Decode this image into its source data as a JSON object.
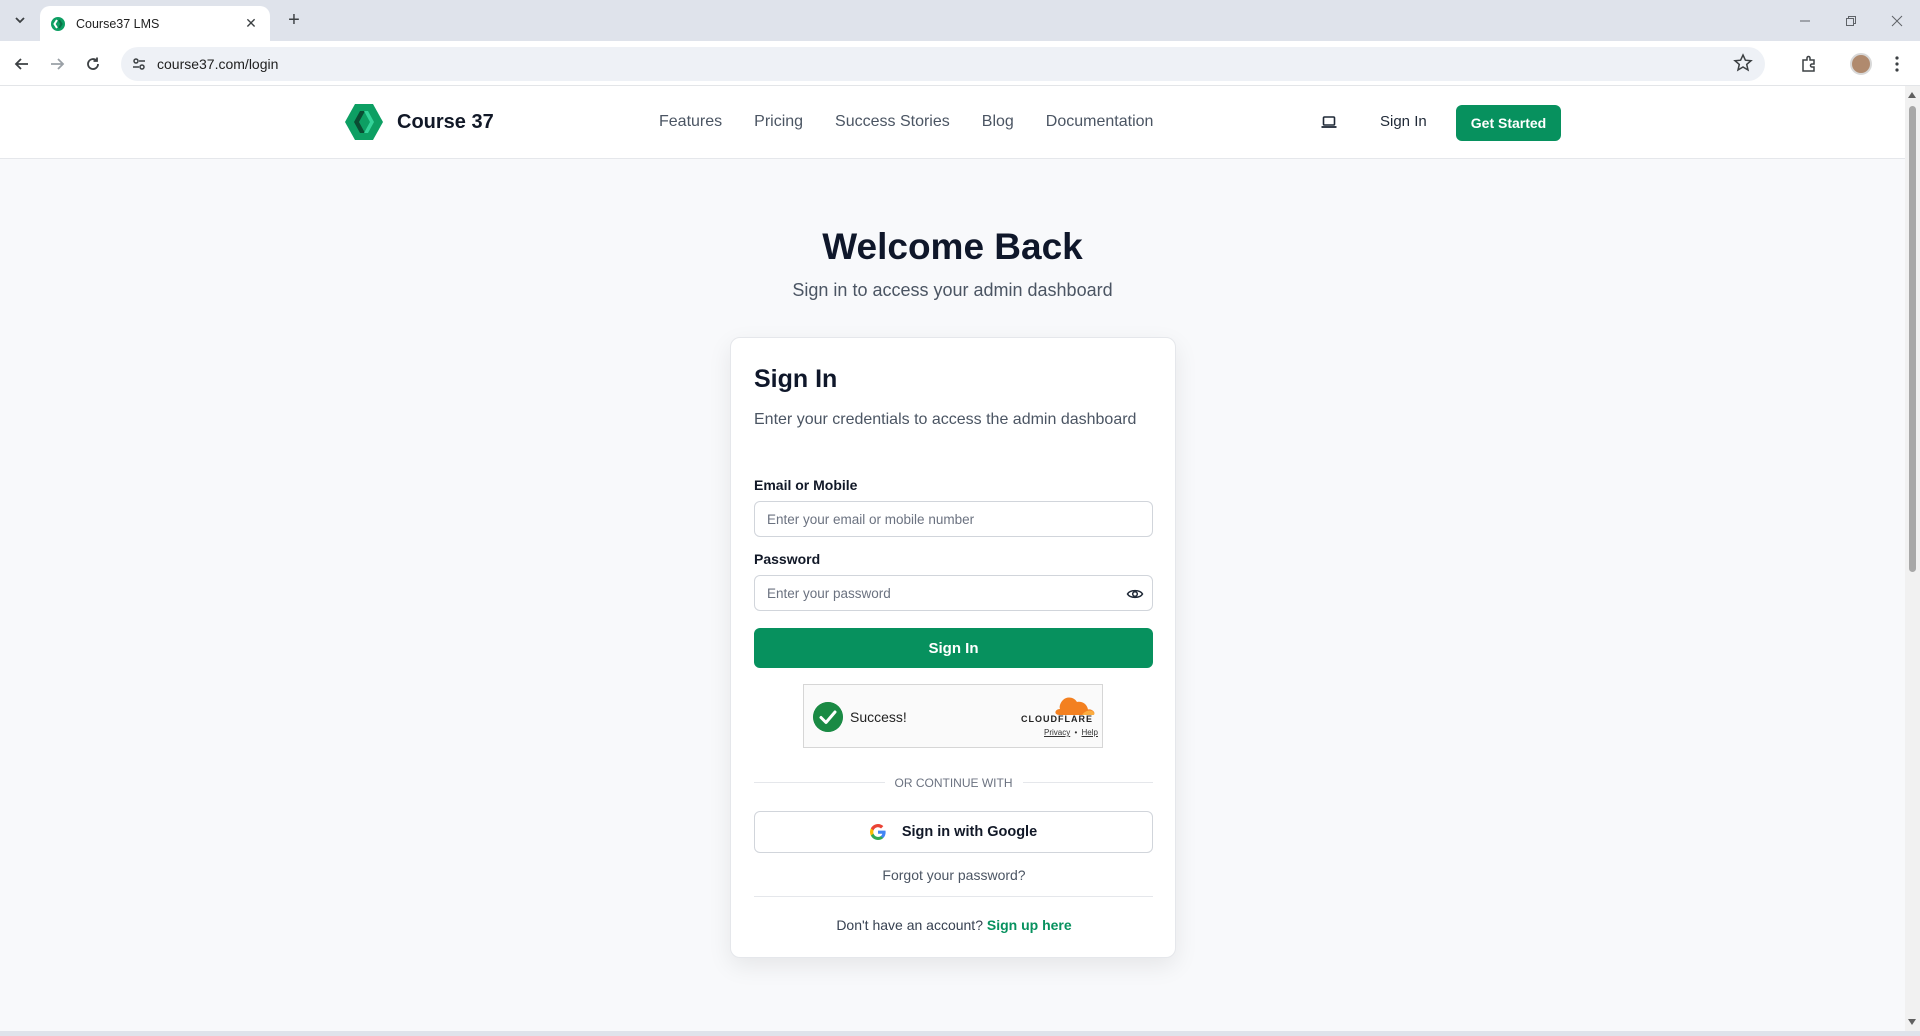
{
  "browser": {
    "tab_title": "Course37 LMS",
    "url": "course37.com/login",
    "new_tab_symbol": "+",
    "tab_close_symbol": "✕"
  },
  "header": {
    "brand_name": "Course 37",
    "nav": [
      "Features",
      "Pricing",
      "Success Stories",
      "Blog",
      "Documentation"
    ],
    "sign_in": "Sign In",
    "get_started": "Get Started"
  },
  "hero": {
    "title": "Welcome Back",
    "subtitle": "Sign in to access your admin dashboard"
  },
  "card": {
    "title": "Sign In",
    "description": "Enter your credentials to access the admin dashboard",
    "email_label": "Email or Mobile",
    "email_placeholder": "Enter your email or mobile number",
    "password_label": "Password",
    "password_placeholder": "Enter your password",
    "submit": "Sign In",
    "divider": "OR CONTINUE WITH",
    "google": "Sign in with Google",
    "forgot": "Forgot your password?",
    "no_account": "Don't have an account?",
    "signup": "Sign up here"
  },
  "captcha": {
    "status": "Success!",
    "brand": "CLOUDFLARE",
    "privacy": "Privacy",
    "separator": "•",
    "help": "Help"
  },
  "colors": {
    "brand_green": "#07915e",
    "captcha_check": "#1a8a44",
    "cloudflare_orange": "#f38020"
  }
}
